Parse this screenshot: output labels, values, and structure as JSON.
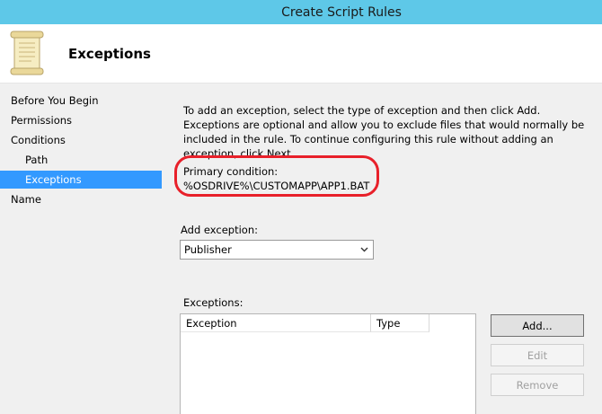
{
  "window": {
    "title": "Create Script Rules"
  },
  "header": {
    "title": "Exceptions",
    "icon": "scroll-icon"
  },
  "sidebar": {
    "items": [
      {
        "label": "Before You Begin"
      },
      {
        "label": "Permissions"
      },
      {
        "label": "Conditions"
      },
      {
        "label": "Path"
      },
      {
        "label": "Exceptions"
      },
      {
        "label": "Name"
      }
    ],
    "active": "Exceptions"
  },
  "main": {
    "intro": "To add an exception, select the type of exception and then click Add. Exceptions are optional and allow you to exclude files that would normally be included in the rule. To continue configuring this rule without adding an exception, click Next.",
    "primary_condition_label": "Primary condition:",
    "primary_condition_value": "%OSDRIVE%\\CUSTOMAPP\\APP1.BAT",
    "add_exception_label": "Add exception:",
    "add_exception_selected": "Publisher",
    "exceptions_label": "Exceptions:",
    "table_headers": [
      "Exception",
      "Type"
    ]
  },
  "buttons": {
    "add": "Add...",
    "edit": "Edit",
    "remove": "Remove"
  },
  "colors": {
    "titlebar": "#5ec8e8",
    "selection": "#3399ff",
    "highlight_ring": "#e8202a"
  }
}
